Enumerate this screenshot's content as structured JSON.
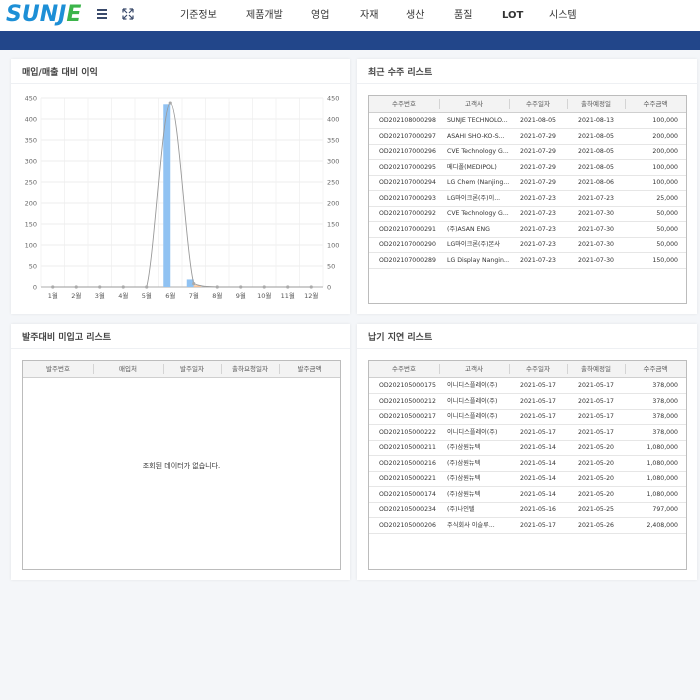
{
  "header": {
    "logo_text_a": "SUNJ",
    "logo_text_b": "E",
    "nav": [
      "기준정보",
      "제품개발",
      "영업",
      "자재",
      "생산",
      "품질",
      "LOT",
      "시스템"
    ]
  },
  "panels": {
    "chart_title": "매입/매출 대비 이익",
    "recent_orders_title": "최근 수주 리스트",
    "unreceived_title": "발주대비 미입고 리스트",
    "delay_title": "납기 지연 리스트"
  },
  "recent_orders": {
    "columns": [
      "수주번호",
      "고객사",
      "수주일자",
      "출하예정일",
      "수주금액"
    ],
    "rows": [
      [
        "OD202108000298",
        "SUNJE TECHNOLO...",
        "2021-08-05",
        "2021-08-13",
        "100,000"
      ],
      [
        "OD202107000297",
        "ASAHI SHO-KO-S...",
        "2021-07-29",
        "2021-08-05",
        "200,000"
      ],
      [
        "OD202107000296",
        "CVE Technology G...",
        "2021-07-29",
        "2021-08-05",
        "200,000"
      ],
      [
        "OD202107000295",
        "메디폴(MEDIPOL)",
        "2021-07-29",
        "2021-08-05",
        "100,000"
      ],
      [
        "OD202107000294",
        "LG Chem (Nanjing...",
        "2021-07-29",
        "2021-08-06",
        "100,000"
      ],
      [
        "OD202107000293",
        "LG마이크론(주)이...",
        "2021-07-23",
        "2021-07-23",
        "25,000"
      ],
      [
        "OD202107000292",
        "CVE Technology G...",
        "2021-07-23",
        "2021-07-30",
        "50,000"
      ],
      [
        "OD202107000291",
        "(주)ASAN ENG",
        "2021-07-23",
        "2021-07-30",
        "50,000"
      ],
      [
        "OD202107000290",
        "LG마이크론(주)본사",
        "2021-07-23",
        "2021-07-30",
        "50,000"
      ],
      [
        "OD202107000289",
        "LG Display Nangin...",
        "2021-07-23",
        "2021-07-30",
        "150,000"
      ]
    ]
  },
  "unreceived": {
    "columns": [
      "발주번호",
      "매입처",
      "발주일자",
      "출하요청일자",
      "발주금액"
    ],
    "empty_message": "조회된 데이터가 없습니다."
  },
  "delay": {
    "columns": [
      "수주번호",
      "고객사",
      "수주일자",
      "출하예정일",
      "수주금액"
    ],
    "rows": [
      [
        "OD202105000175",
        "이니디스플레이(주)",
        "2021-05-17",
        "2021-05-17",
        "378,000"
      ],
      [
        "OD202105000212",
        "이니디스플레이(주)",
        "2021-05-17",
        "2021-05-17",
        "378,000"
      ],
      [
        "OD202105000217",
        "이니디스플레이(주)",
        "2021-05-17",
        "2021-05-17",
        "378,000"
      ],
      [
        "OD202105000222",
        "이니디스플레이(주)",
        "2021-05-17",
        "2021-05-17",
        "378,000"
      ],
      [
        "OD202105000211",
        "(주)삼원뉴텍",
        "2021-05-14",
        "2021-05-20",
        "1,080,000"
      ],
      [
        "OD202105000216",
        "(주)삼원뉴텍",
        "2021-05-14",
        "2021-05-20",
        "1,080,000"
      ],
      [
        "OD202105000221",
        "(주)삼원뉴텍",
        "2021-05-14",
        "2021-05-20",
        "1,080,000"
      ],
      [
        "OD202105000174",
        "(주)삼원뉴텍",
        "2021-05-14",
        "2021-05-20",
        "1,080,000"
      ],
      [
        "OD202105000234",
        "(주)나인텔",
        "2021-05-16",
        "2021-05-25",
        "797,000"
      ],
      [
        "OD202105000206",
        "주식회사 이슬루...",
        "2021-05-17",
        "2021-05-26",
        "2,408,000"
      ]
    ]
  },
  "chart_data": {
    "type": "bar",
    "categories": [
      "1월",
      "2월",
      "3월",
      "4월",
      "5월",
      "6월",
      "7월",
      "8월",
      "9월",
      "10월",
      "11월",
      "12월"
    ],
    "series": [
      {
        "type": "bar",
        "color": "#90c2f2",
        "values": [
          0,
          0,
          0,
          0,
          0,
          435,
          18,
          0,
          0,
          0,
          0,
          0
        ]
      },
      {
        "type": "bar",
        "color": "#f5c29a",
        "values": [
          0,
          0,
          0,
          0,
          0,
          0,
          4,
          0,
          0,
          0,
          0,
          0
        ]
      },
      {
        "type": "line",
        "color": "#999999",
        "values": [
          0,
          0,
          0,
          0,
          0,
          438,
          8,
          0,
          0,
          0,
          0,
          0
        ]
      }
    ],
    "yticks": [
      0,
      50,
      100,
      150,
      200,
      250,
      300,
      350,
      400,
      450
    ],
    "ylim": [
      0,
      450
    ],
    "grid": true
  }
}
